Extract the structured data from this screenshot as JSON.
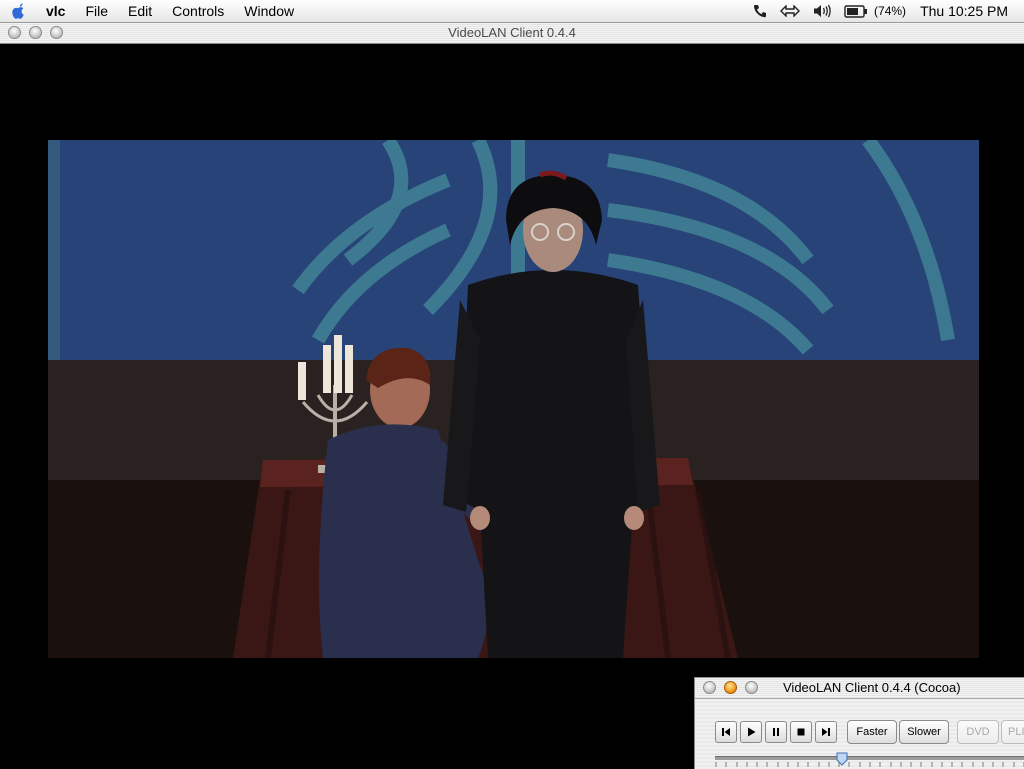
{
  "menubar": {
    "app_name": "vlc",
    "items": [
      {
        "label": "File"
      },
      {
        "label": "Edit"
      },
      {
        "label": "Controls"
      },
      {
        "label": "Window"
      }
    ],
    "battery_percent": "(74%)",
    "clock": "Thu 10:25 PM"
  },
  "main_window": {
    "title": "VideoLAN Client 0.4.4"
  },
  "controller": {
    "title": "VideoLAN Client 0.4.4 (Cocoa)",
    "faster_label": "Faster",
    "slower_label": "Slower",
    "dvd_label": "DVD",
    "playlist_label": "PLIST",
    "position_fraction": 0.41
  },
  "colors": {
    "window_minimize_amber": "#f3a120",
    "video_background": "#000000"
  }
}
